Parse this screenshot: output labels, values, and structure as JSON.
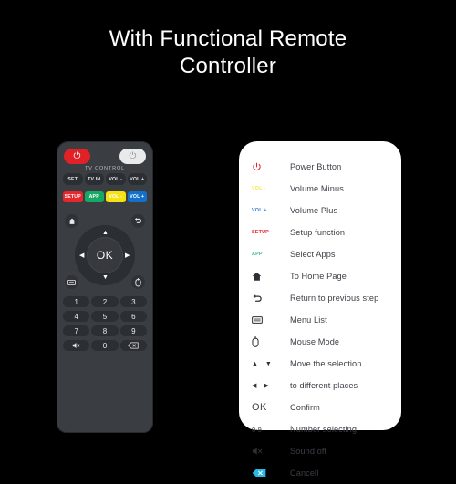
{
  "title": {
    "line1": "With Functional Remote",
    "line2": "Controller"
  },
  "colors": {
    "background": "#000000",
    "panel": "#ffffff",
    "remote_body": "#3a3d41",
    "accent_red": "#e02127",
    "accent_green": "#18a866",
    "accent_yellow": "#f5e215",
    "accent_blue": "#1471c9",
    "cancel_key": "#28b9e8"
  },
  "remote": {
    "power_buttons": [
      {
        "name": "power-red",
        "glyph": "⏻",
        "color": "#e02127"
      },
      {
        "name": "power-white",
        "glyph": "⏻",
        "color": "#e9eaec"
      }
    ],
    "section_label": "TV CONTROL",
    "tv_control_row": [
      "SET",
      "TV IN",
      "VOL -",
      "VOL +"
    ],
    "color_row": [
      {
        "label": "SETUP",
        "color": "#e8262d"
      },
      {
        "label": "APP",
        "color": "#18a866"
      },
      {
        "label": "VOL -",
        "color": "#f5e215"
      },
      {
        "label": "VOL +",
        "color": "#1471c9"
      }
    ],
    "dpad": {
      "center": "OK",
      "up": "▲",
      "down": "▼",
      "left": "◀",
      "right": "▶"
    },
    "corner_buttons": [
      {
        "name": "home",
        "position": "top-left"
      },
      {
        "name": "back",
        "position": "top-right"
      },
      {
        "name": "menu",
        "position": "bottom-left"
      },
      {
        "name": "mouse",
        "position": "bottom-right"
      }
    ],
    "keypad": [
      [
        "1",
        "2",
        "3"
      ],
      [
        "4",
        "5",
        "6"
      ],
      [
        "7",
        "8",
        "9"
      ],
      [
        "🔇",
        "0",
        "⌫"
      ]
    ]
  },
  "legend": {
    "items": [
      {
        "icon": "power-icon",
        "icon_text": "",
        "icon_color": "#e02127",
        "label": "Power Button"
      },
      {
        "icon": "vol-minus-icon",
        "icon_text": "VOL -",
        "icon_color": "#f7e84a",
        "label": "Volume Minus"
      },
      {
        "icon": "vol-plus-icon",
        "icon_text": "VOL +",
        "icon_color": "#2f7fd0",
        "label": "Volume Plus"
      },
      {
        "icon": "setup-icon",
        "icon_text": "SETUP",
        "icon_color": "#e02127",
        "label": "Setup function"
      },
      {
        "icon": "app-icon",
        "icon_text": "APP",
        "icon_color": "#35b97f",
        "label": "Select Apps"
      },
      {
        "icon": "home-icon",
        "icon_text": "",
        "icon_color": "#2d3035",
        "label": "To Home Page"
      },
      {
        "icon": "return-icon",
        "icon_text": "",
        "icon_color": "#2d3035",
        "label": "Return to previous step"
      },
      {
        "icon": "menu-list-icon",
        "icon_text": "",
        "icon_color": "#2d3035",
        "label": "Menu List"
      },
      {
        "icon": "mouse-icon",
        "icon_text": "",
        "icon_color": "#2d3035",
        "label": "Mouse Mode"
      },
      {
        "icon": "arrows-up-down-icon",
        "icon_text": "▲ ▼",
        "icon_color": "#2d3035",
        "label": "Move the selection"
      },
      {
        "icon": "arrows-left-right-icon",
        "icon_text": "◀ ▶",
        "icon_color": "#2d3035",
        "label": "to different places"
      },
      {
        "icon": "ok-icon",
        "icon_text": "OK",
        "icon_color": "#3b3f45",
        "label": "Confirm"
      },
      {
        "icon": "numbers-icon",
        "icon_text": "0-9",
        "icon_color": "#3b3f45",
        "label": "Number selecting"
      },
      {
        "icon": "mute-icon",
        "icon_text": "",
        "icon_color": "#2d3035",
        "label": "Sound off"
      },
      {
        "icon": "cancel-icon",
        "icon_text": "⌫",
        "icon_color": "#28b9e8",
        "label": "Cancell"
      }
    ]
  }
}
